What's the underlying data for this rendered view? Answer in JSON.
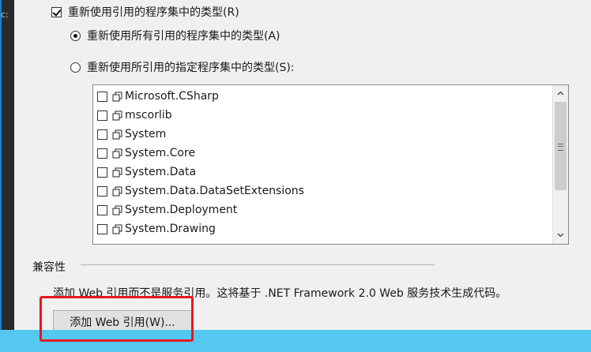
{
  "settings": {
    "reuse_types_checkbox": {
      "label": "重新使用引用的程序集中的类型(R)",
      "checked": true
    },
    "reuse_all_radio": {
      "label": "重新使用所有引用的程序集中的类型(A)",
      "selected": true
    },
    "reuse_specified_radio": {
      "label": "重新使用所引用的指定程序集中的类型(S):",
      "selected": false
    }
  },
  "assemblies": [
    {
      "name": "Microsoft.CSharp",
      "checked": false
    },
    {
      "name": "mscorlib",
      "checked": false
    },
    {
      "name": "System",
      "checked": false
    },
    {
      "name": "System.Core",
      "checked": false
    },
    {
      "name": "System.Data",
      "checked": false
    },
    {
      "name": "System.Data.DataSetExtensions",
      "checked": false
    },
    {
      "name": "System.Deployment",
      "checked": false
    },
    {
      "name": "System.Drawing",
      "checked": false
    }
  ],
  "compatibility": {
    "title": "兼容性",
    "description": "添加 Web 引用而不是服务引用。这将基于 .NET Framework 2.0 Web 服务技术生成代码。",
    "add_web_reference_button": "添加 Web 引用(W)..."
  },
  "left_strip_fragment": "c:",
  "colors": {
    "highlight": "#e8161c",
    "taskbar": "#54c8ee",
    "dialog_bg": "#f0f0f0"
  },
  "icons": {
    "assembly": "assembly-icon",
    "scroll_up": "chevron-up-icon",
    "scroll_down": "chevron-down-icon"
  }
}
